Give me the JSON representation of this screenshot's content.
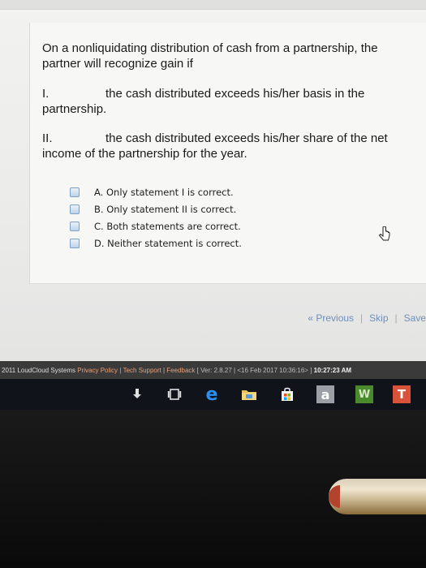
{
  "question": {
    "stem": "On a nonliquidating distribution of cash from a partnership, the partner will recognize gain if",
    "statement_1": {
      "number": "I.",
      "text": "the cash distributed exceeds his/her basis in the partnership."
    },
    "statement_2": {
      "number": "II.",
      "text": "the cash distributed exceeds his/her share of the net income of the partnership for the year."
    }
  },
  "answers": [
    {
      "label": "A. Only statement I is correct."
    },
    {
      "label": "B. Only statement II is correct."
    },
    {
      "label": "C. Both statements are correct."
    },
    {
      "label": "D. Neither statement is correct."
    }
  ],
  "nav": {
    "previous": "« Previous",
    "skip": "Skip",
    "save": "Save"
  },
  "footer": {
    "copyright": "2011 LoudCloud Systems",
    "privacy": "Privacy Policy",
    "tech_support": "Tech Support",
    "feedback": "Feedback",
    "version": "[ Ver: 2.8.27 | <16 Feb 2017 10:36:16> ]",
    "time": "10:27:23 AM"
  },
  "taskbar": {
    "icons": [
      "download-icon",
      "task-view-icon",
      "edge-icon",
      "file-explorer-icon",
      "store-icon",
      "amazon-icon",
      "word-icon",
      "t-app-icon"
    ],
    "amazon_letter": "a",
    "word_letter": "W",
    "t_letter": "T"
  },
  "colors": {
    "checkbox_border": "#7ea1c7",
    "nav_link": "#6f8fb8",
    "footer_link": "#e8a07a"
  }
}
